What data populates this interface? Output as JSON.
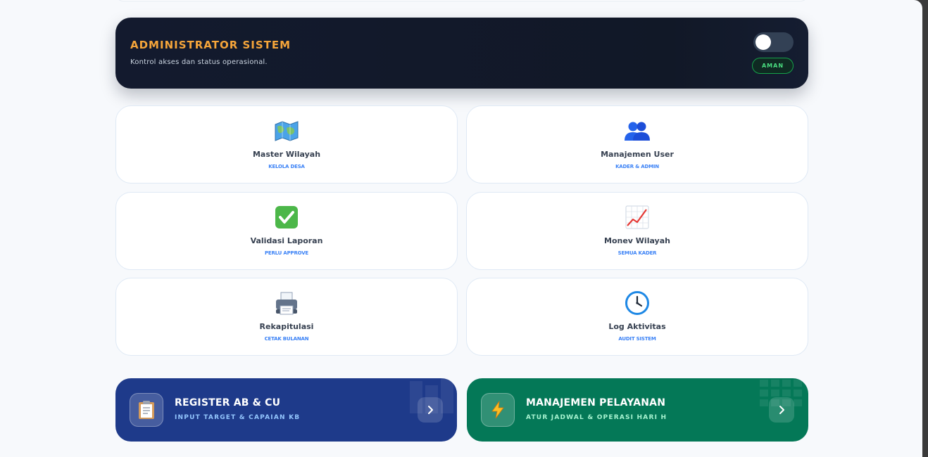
{
  "admin": {
    "title": "ADMINISTRATOR SISTEM",
    "subtitle": "Kontrol akses dan status operasional.",
    "toggle_on": false,
    "status": "AMAN"
  },
  "menu": [
    {
      "label": "Master Wilayah",
      "sub": "KELOLA DESA",
      "icon": "map-icon"
    },
    {
      "label": "Manajemen User",
      "sub": "KADER & ADMIN",
      "icon": "users-icon"
    },
    {
      "label": "Validasi Laporan",
      "sub": "PERLU APPROVE",
      "icon": "check-icon"
    },
    {
      "label": "Monev Wilayah",
      "sub": "SEMUA KADER",
      "icon": "chart-up-icon"
    },
    {
      "label": "Rekapitulasi",
      "sub": "CETAK BULANAN",
      "icon": "printer-icon"
    },
    {
      "label": "Log Aktivitas",
      "sub": "AUDIT SISTEM",
      "icon": "clock-icon"
    }
  ],
  "actions": [
    {
      "title": "REGISTER AB & CU",
      "sub": "INPUT TARGET & CAPAIAN KB",
      "icon": "clipboard-icon",
      "color": "#1e3a8a"
    },
    {
      "title": "MANAJEMEN PELAYANAN",
      "sub": "ATUR JADWAL & OPERASI HARI H",
      "icon": "lightning-icon",
      "color": "#047857"
    }
  ]
}
